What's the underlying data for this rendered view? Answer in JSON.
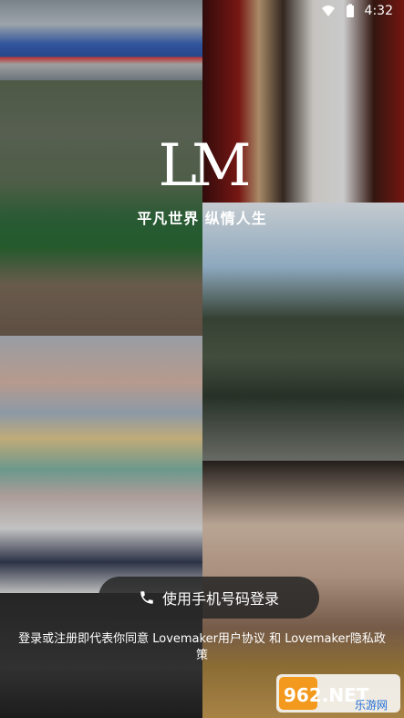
{
  "status_bar": {
    "time": "4:32"
  },
  "brand": {
    "logo_text": "LM",
    "slogan": "平凡世界 纵情人生"
  },
  "login": {
    "button_label": "使用手机号码登录"
  },
  "agreement": {
    "prefix": "登录或注册即代表你同意 ",
    "user_agreement": "Lovemaker用户协议",
    "connector": " 和 ",
    "privacy_policy": "Lovemaker隐私政策"
  },
  "watermark": {
    "logo": "962.NET",
    "caption": "乐游网"
  },
  "colors": {
    "button_bg": "#282828",
    "text": "#ffffff"
  }
}
